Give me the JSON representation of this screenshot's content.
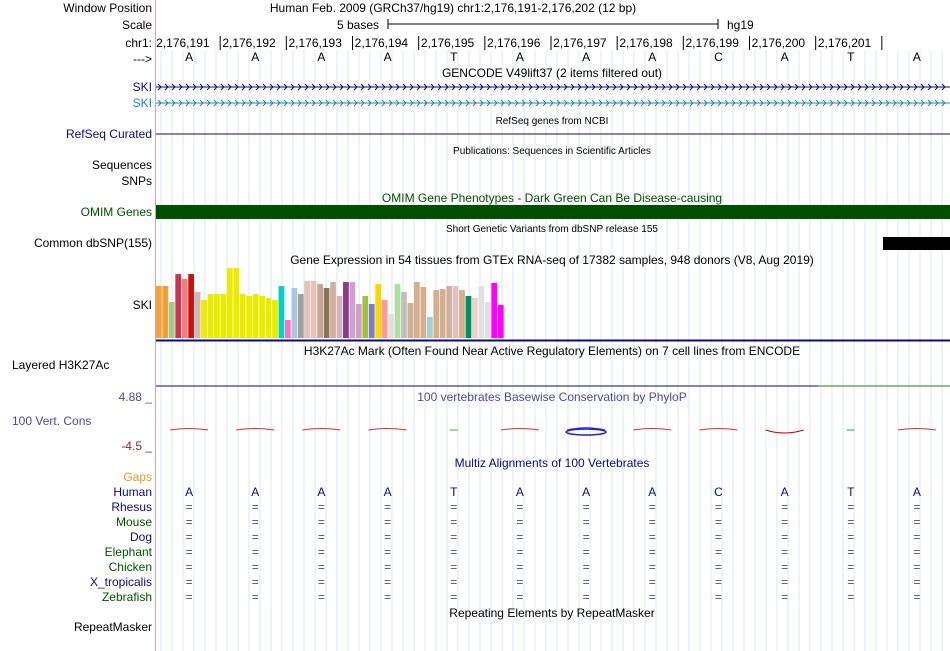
{
  "header": {
    "labels": [
      "Window Position",
      "Scale",
      "chr1:",
      "--->"
    ],
    "position_text": "Human Feb. 2009 (GRCh37/hg19)   chr1:2,176,191-2,176,202 (12 bp)",
    "scale_text": "5 bases",
    "scale_assembly": "hg19",
    "coords": [
      "2,176,191",
      "2,176,192",
      "2,176,193",
      "2,176,194",
      "2,176,195",
      "2,176,196",
      "2,176,197",
      "2,176,198",
      "2,176,199",
      "2,176,200",
      "2,176,201"
    ],
    "bases": [
      "A",
      "A",
      "A",
      "A",
      "T",
      "A",
      "A",
      "A",
      "C",
      "A",
      "T",
      "A"
    ]
  },
  "tracks": {
    "gencode": {
      "title": "GENCODE V49lift37 (2 items filtered out)",
      "items": [
        "SKI",
        "SKI"
      ],
      "colors": [
        "#0b0b7a",
        "#1a8aa8"
      ]
    },
    "refseq": {
      "title": "RefSeq genes from NCBI",
      "label": "RefSeq Curated",
      "color": "#0b0b7a"
    },
    "publications": {
      "title": "Publications: Sequences in Scientific Articles",
      "labels": [
        "Sequences",
        "SNPs"
      ]
    },
    "omim": {
      "title": "OMIM Gene Phenotypes - Dark Green Can Be Disease-causing",
      "label": "OMIM Genes",
      "color": "#005000"
    },
    "dbsnp": {
      "title": "Short Genetic Variants from dbSNP release 155",
      "label": "Common dbSNP(155)"
    },
    "gtex": {
      "title": "Gene Expression in 54 tissues from GTEx RNA-seq of 17382 samples, 948 donors (V8, Aug 2019)",
      "label": "SKI",
      "values": [
        52,
        52,
        36,
        64,
        59,
        64,
        46,
        38,
        44,
        44,
        44,
        70,
        70,
        44,
        42,
        44,
        42,
        40,
        38,
        52,
        18,
        50,
        44,
        57,
        57,
        54,
        50,
        56,
        42,
        56,
        56,
        34,
        42,
        34,
        54,
        38,
        24,
        54,
        46,
        35,
        56,
        51,
        21,
        48,
        49,
        52,
        52,
        48,
        42,
        40,
        52,
        36,
        55,
        33
      ],
      "colors": [
        "#f7a040",
        "#f79a30",
        "#9ecc8c",
        "#cc3355",
        "#f08080",
        "#cc1111",
        "#dab4b4",
        "#ebeb00",
        "#ebeb00",
        "#ebeb00",
        "#ebeb00",
        "#ebeb00",
        "#ebeb00",
        "#ebeb00",
        "#ebeb00",
        "#ebeb00",
        "#ebeb00",
        "#ebeb00",
        "#ebeb00",
        "#00d0d0",
        "#ff70c0",
        "#a8c8e0",
        "#a0a0a0",
        "#e6c2b8",
        "#e6c2b8",
        "#c4a894",
        "#8b7355",
        "#d0b0a0",
        "#d4b4b4",
        "#8b3a8b",
        "#d0a0d0",
        "#d0a0c0",
        "#a0c040",
        "#7b7bd0",
        "#ffd700",
        "#ff9999",
        "#e0e0e0",
        "#b0e0a0",
        "#c0c0c0",
        "#d4b090",
        "#d4b090",
        "#d4b090",
        "#a0d0d0",
        "#d4b090",
        "#d4b090",
        "#d0b0a0",
        "#e0c0c0",
        "#d4b090",
        "#009060",
        "#f0d0d0",
        "#e0e0e0",
        "#e0e0e0",
        "#ff00ff",
        "#ff00ff"
      ]
    },
    "h3k27ac": {
      "title": "H3K27Ac Mark (Often Found Near Active Regulatory Elements) on 7 cell lines from ENCODE",
      "label": "Layered H3K27Ac"
    },
    "phylop": {
      "title": "100 vertebrates Basewise Conservation by PhyloP",
      "label": "100 Vert. Cons",
      "ymax": "4.88 _",
      "ymin": "-4.5 _"
    },
    "multiz": {
      "title": "Multiz Alignments of 100 Vertebrates",
      "gaps_label": "Gaps",
      "species": [
        "Human",
        "Rhesus",
        "Mouse",
        "Dog",
        "Elephant",
        "Chicken",
        "X_tropicalis",
        "Zebrafish"
      ],
      "species_colors": [
        "#0b0b7a",
        "#0b0b7a",
        "#005000",
        "#0b0b7a",
        "#005000",
        "#005000",
        "#0b0b7a",
        "#005000"
      ],
      "human_bases": [
        "A",
        "A",
        "A",
        "A",
        "T",
        "A",
        "A",
        "A",
        "C",
        "A",
        "T",
        "A"
      ],
      "match_symbol": "="
    },
    "repeatmasker": {
      "title": "Repeating Elements by RepeatMasker",
      "label": "RepeatMasker"
    }
  }
}
